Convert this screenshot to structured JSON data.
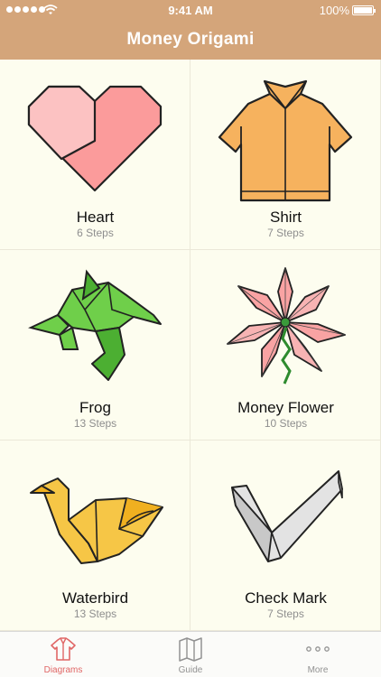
{
  "status_bar": {
    "time": "9:41 AM",
    "battery": "100%"
  },
  "nav": {
    "title": "Money Origami"
  },
  "diagrams": [
    {
      "title": "Heart",
      "steps": "6 Steps",
      "icon": "heart-icon"
    },
    {
      "title": "Shirt",
      "steps": "7 Steps",
      "icon": "shirt-icon"
    },
    {
      "title": "Frog",
      "steps": "13 Steps",
      "icon": "frog-icon"
    },
    {
      "title": "Money Flower",
      "steps": "10 Steps",
      "icon": "flower-icon"
    },
    {
      "title": "Waterbird",
      "steps": "13 Steps",
      "icon": "waterbird-icon"
    },
    {
      "title": "Check Mark",
      "steps": "7 Steps",
      "icon": "check-mark-icon"
    }
  ],
  "tabs": [
    {
      "label": "Diagrams",
      "icon": "shirt-outline-icon",
      "active": true
    },
    {
      "label": "Guide",
      "icon": "map-icon",
      "active": false
    },
    {
      "label": "More",
      "icon": "ellipsis-icon",
      "active": false
    }
  ],
  "colors": {
    "accent": "#d4a57a",
    "background": "#fdfdef",
    "active_tab": "#e06666",
    "inactive_tab": "#929292"
  }
}
